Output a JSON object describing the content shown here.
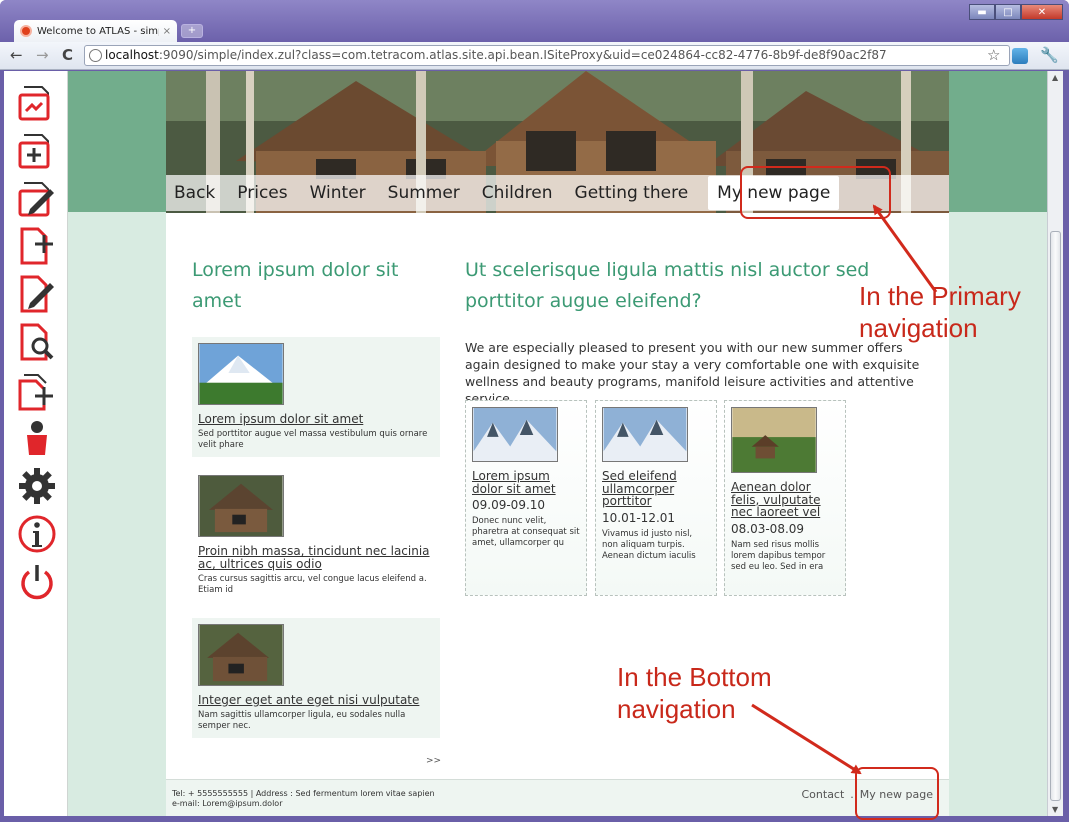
{
  "browser": {
    "tab_title": "Welcome to ATLAS - simpl",
    "tab_close": "×",
    "new_tab": "+",
    "url_host": "localhost",
    "url_rest": ":9090/simple/index.zul?class=com.tetracom.atlas.site.api.bean.ISiteProxy&uid=ce024864-cc82-4776-8b9f-de8f90ac2f87",
    "back": "←",
    "forward": "→",
    "reload": "C",
    "star": "☆",
    "wrench": "🔧",
    "minimize": "▬",
    "maximize": "□",
    "close": "✕"
  },
  "cms_toolbar": {
    "icons": [
      "pages-icon",
      "add-page-icon",
      "edit-page-icon",
      "new-document-icon",
      "edit-document-icon",
      "search-document-icon",
      "add-document-icon",
      "user-icon",
      "settings-gear-icon",
      "info-icon",
      "power-icon"
    ]
  },
  "primary_nav": {
    "items": [
      "Back",
      "Prices",
      "Winter",
      "Summer",
      "Children",
      "Getting there"
    ],
    "active": "My new page"
  },
  "left_col": {
    "heading": "Lorem ipsum dolor sit amet",
    "teasers": [
      {
        "title": "Lorem ipsum dolor sit amet",
        "text": "Sed porttitor augue vel massa vestibulum quis ornare velit phare"
      },
      {
        "title": "Proin nibh massa, tincidunt nec lacinia ac, ultrices quis odio",
        "text": "Cras cursus sagittis arcu, vel congue lacus eleifend a. Etiam id"
      },
      {
        "title": "Integer eget ante eget nisi vulputate",
        "text": "Nam sagittis ullamcorper ligula, eu sodales nulla semper nec."
      }
    ],
    "more": ">>"
  },
  "right_col": {
    "heading": "Ut scelerisque ligula mattis nisl auctor sed porttitor augue eleifend?",
    "intro": "We are especially pleased to present you with our new summer offers again designed to make your stay a very comfortable one with exquisite wellness and beauty programs, manifold leisure activities and attentive service.",
    "offers": [
      {
        "title": "Lorem ipsum dolor sit amet",
        "date": "09.09-09.10",
        "text": "Donec nunc velit, pharetra at consequat sit amet, ullamcorper qu"
      },
      {
        "title": "Sed eleifend ullamcorper porttitor",
        "date": "10.01-12.01",
        "text": "Vivamus id justo nisl, non aliquam turpis. Aenean dictum iaculis"
      },
      {
        "title": "Aenean dolor felis, vulputate nec laoreet vel",
        "date": "08.03-08.09",
        "text": "Nam sed risus mollis lorem dapibus tempor sed eu leo. Sed in era"
      }
    ]
  },
  "footer": {
    "line1": "Tel: + 5555555555 | Address : Sed fermentum lorem vitae sapien",
    "line2": "e-mail: Lorem@ipsum.dolor",
    "nav": [
      "Contact",
      "My new page"
    ],
    "separator": "."
  },
  "annotations": {
    "primary": "In the Primary navigation",
    "bottom": "In the Bottom navigation",
    "color": "#d12a1c"
  },
  "colors": {
    "site_green": "#72ad8c",
    "heading_green": "#3c9a74",
    "cms_red": "#e0262b"
  }
}
